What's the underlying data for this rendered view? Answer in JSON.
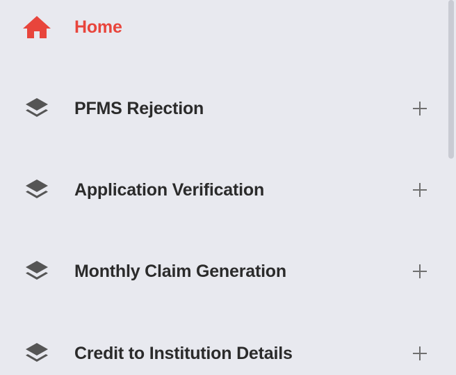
{
  "colors": {
    "background": "#e8e9ef",
    "active": "#e8453c",
    "text": "#2b2b2b",
    "icon": "#555555",
    "expand": "#6f6f6f"
  },
  "menu": {
    "items": [
      {
        "label": "Home",
        "icon": "home-icon",
        "active": true,
        "expandable": false
      },
      {
        "label": "PFMS Rejection",
        "icon": "layers-icon",
        "active": false,
        "expandable": true,
        "expand_icon": "plus-icon"
      },
      {
        "label": "Application Verification",
        "icon": "layers-icon",
        "active": false,
        "expandable": true,
        "expand_icon": "plus-icon"
      },
      {
        "label": "Monthly Claim Generation",
        "icon": "layers-icon",
        "active": false,
        "expandable": true,
        "expand_icon": "plus-icon"
      },
      {
        "label": "Credit to Institution Details",
        "icon": "layers-icon",
        "active": false,
        "expandable": true,
        "expand_icon": "plus-icon"
      }
    ]
  }
}
